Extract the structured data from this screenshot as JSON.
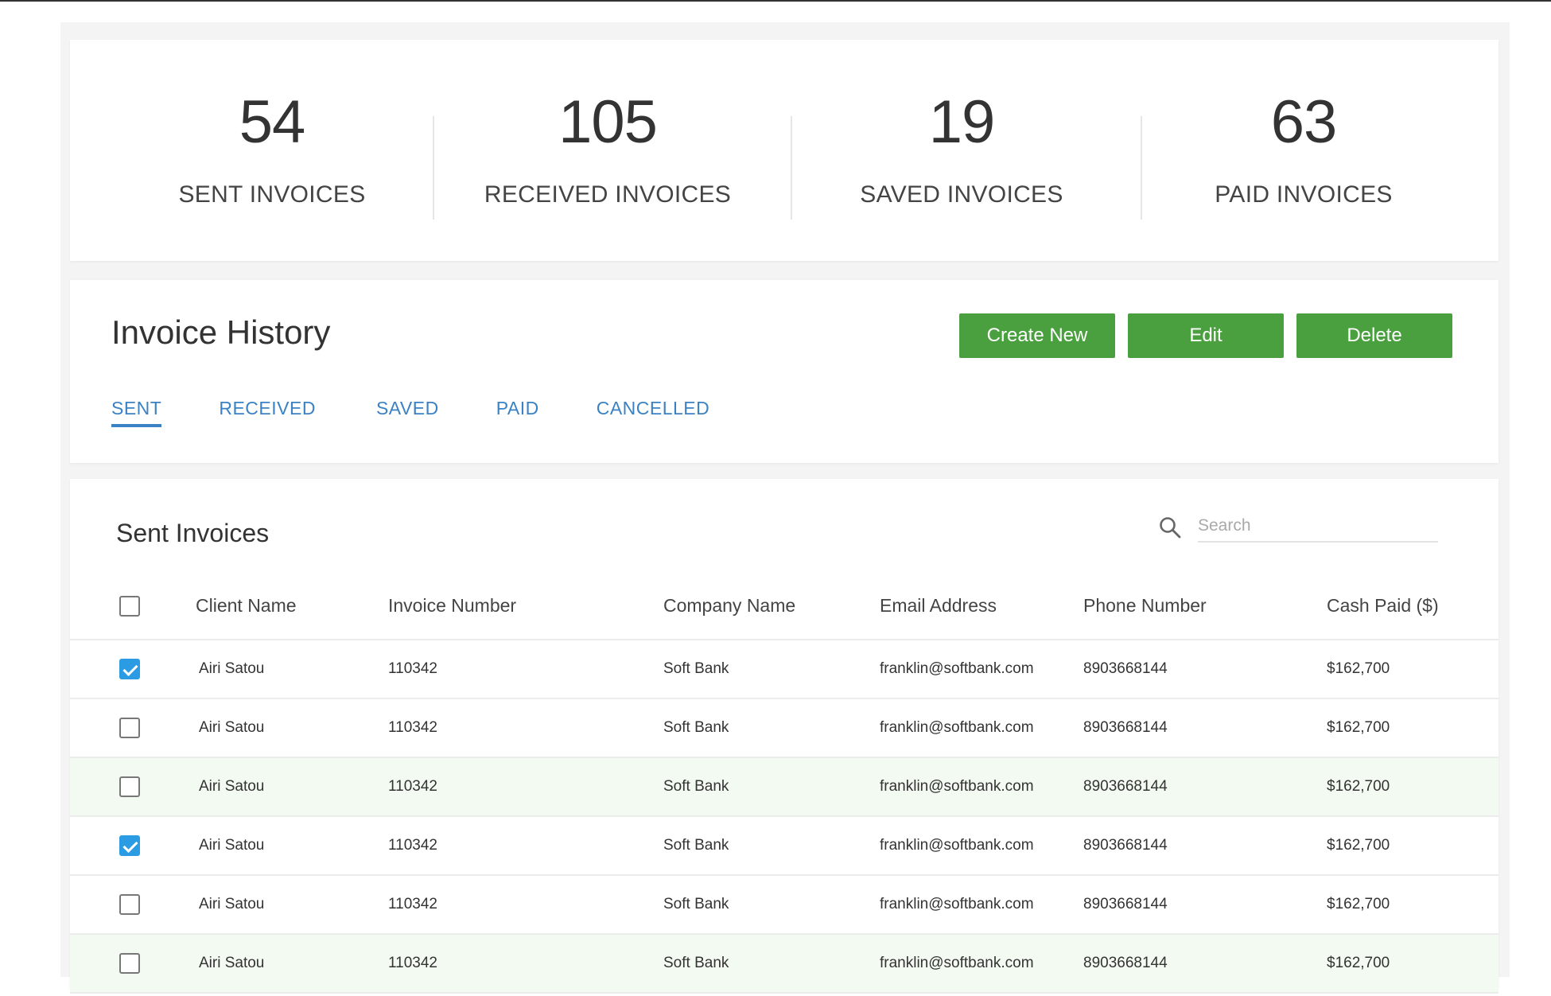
{
  "stats": [
    {
      "value": "54",
      "label": "SENT INVOICES"
    },
    {
      "value": "105",
      "label": "RECEIVED INVOICES"
    },
    {
      "value": "19",
      "label": "SAVED INVOICES"
    },
    {
      "value": "63",
      "label": "PAID INVOICES"
    }
  ],
  "history": {
    "title": "Invoice History",
    "buttons": {
      "create": "Create New",
      "edit": "Edit",
      "delete": "Delete"
    },
    "tabs": [
      "SENT",
      "RECEIVED",
      "SAVED",
      "PAID",
      "CANCELLED"
    ],
    "active_tab": "SENT"
  },
  "table": {
    "title": "Sent Invoices",
    "search_placeholder": "Search",
    "columns": [
      "Client Name",
      "Invoice Number",
      "Company Name",
      "Email Address",
      "Phone Number",
      "Cash Paid ($)"
    ],
    "rows": [
      {
        "checked": true,
        "client": "Airi Satou",
        "invoice": "110342",
        "company": "Soft Bank",
        "email": "franklin@softbank.com",
        "phone": "8903668144",
        "cash": "$162,700"
      },
      {
        "checked": false,
        "client": "Airi Satou",
        "invoice": "110342",
        "company": "Soft Bank",
        "email": "franklin@softbank.com",
        "phone": "8903668144",
        "cash": "$162,700"
      },
      {
        "checked": false,
        "client": "Airi Satou",
        "invoice": "110342",
        "company": "Soft Bank",
        "email": "franklin@softbank.com",
        "phone": "8903668144",
        "cash": "$162,700"
      },
      {
        "checked": true,
        "client": "Airi Satou",
        "invoice": "110342",
        "company": "Soft Bank",
        "email": "franklin@softbank.com",
        "phone": "8903668144",
        "cash": "$162,700"
      },
      {
        "checked": false,
        "client": "Airi Satou",
        "invoice": "110342",
        "company": "Soft Bank",
        "email": "franklin@softbank.com",
        "phone": "8903668144",
        "cash": "$162,700"
      },
      {
        "checked": false,
        "client": "Airi Satou",
        "invoice": "110342",
        "company": "Soft Bank",
        "email": "franklin@softbank.com",
        "phone": "8903668144",
        "cash": "$162,700"
      }
    ]
  },
  "colors": {
    "accent_green": "#4a9f3f",
    "tab_blue": "#3b82c4",
    "checkbox_blue": "#2b9be4",
    "row_highlight": "#f3faf1"
  },
  "icons": {
    "search": "search-icon",
    "checkbox": "checkbox-icon"
  }
}
